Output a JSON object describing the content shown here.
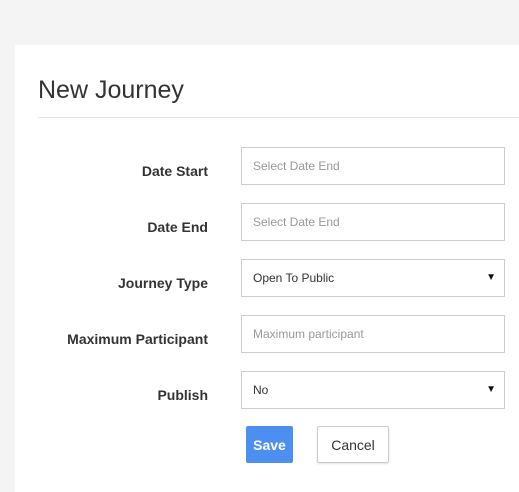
{
  "colors": {
    "page_background": "#f4f4f4",
    "card_background": "#ffffff",
    "primary_button": "#4d8ff0",
    "input_border": "#cccccc",
    "text": "#333333"
  },
  "form": {
    "title": "New Journey",
    "fields": {
      "date_start": {
        "label": "Date Start",
        "value": "",
        "placeholder": "Select Date End"
      },
      "date_end": {
        "label": "Date End",
        "value": "",
        "placeholder": "Select Date End"
      },
      "journey_type": {
        "label": "Journey Type",
        "selected": "Open To Public"
      },
      "maximum_participant": {
        "label": "Maximum Participant",
        "value": "",
        "placeholder": "Maximum participant"
      },
      "publish": {
        "label": "Publish",
        "selected": "No"
      }
    },
    "icons": {
      "select_arrow": "▼"
    },
    "buttons": {
      "save_label": "Save",
      "cancel_label": "Cancel"
    }
  }
}
